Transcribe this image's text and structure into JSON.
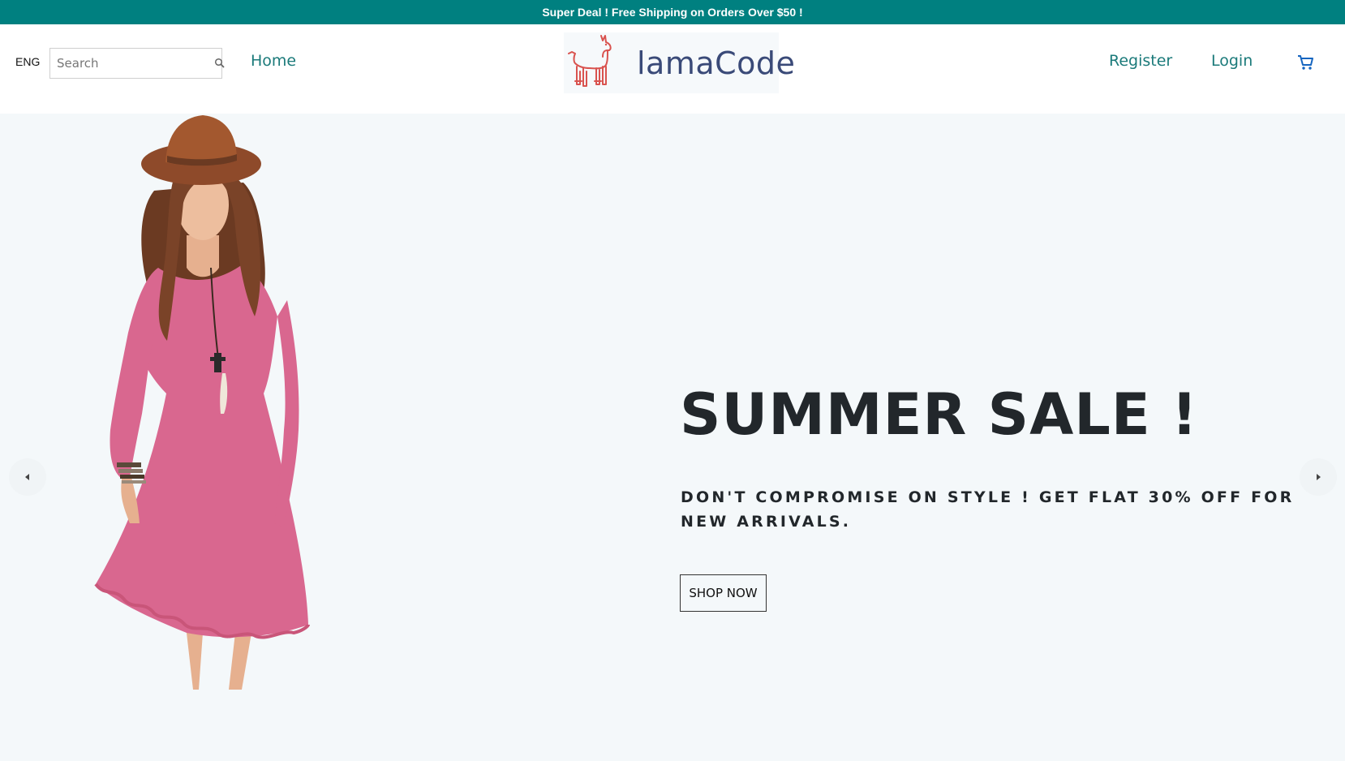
{
  "announcement": {
    "text": "Super Deal ! Free Shipping on Orders Over $50 !"
  },
  "navbar": {
    "language": "ENG",
    "search": {
      "placeholder": "Search",
      "value": ""
    },
    "home_label": "Home",
    "logo_text": "lamaCode",
    "register_label": "Register",
    "login_label": "Login",
    "icons": {
      "search": "search-icon",
      "cart": "cart-icon",
      "logo": "llama-icon"
    }
  },
  "slider": {
    "headline": "SUMMER SALE !",
    "subtext": "DON'T COMPROMISE ON STYLE ! GET FLAT 30% OFF FOR NEW ARRIVALS.",
    "button_label": "SHOP NOW",
    "icons": {
      "prev": "arrow-left-icon",
      "next": "arrow-right-icon"
    }
  },
  "colors": {
    "announcement_bg": "#008080",
    "link": "#1b7a7a",
    "cart": "#1565c0",
    "slider_bg": "#f4f8fa",
    "dress": "#d9678f",
    "logo_text": "#3a4a78",
    "llama": "#d9534f"
  }
}
